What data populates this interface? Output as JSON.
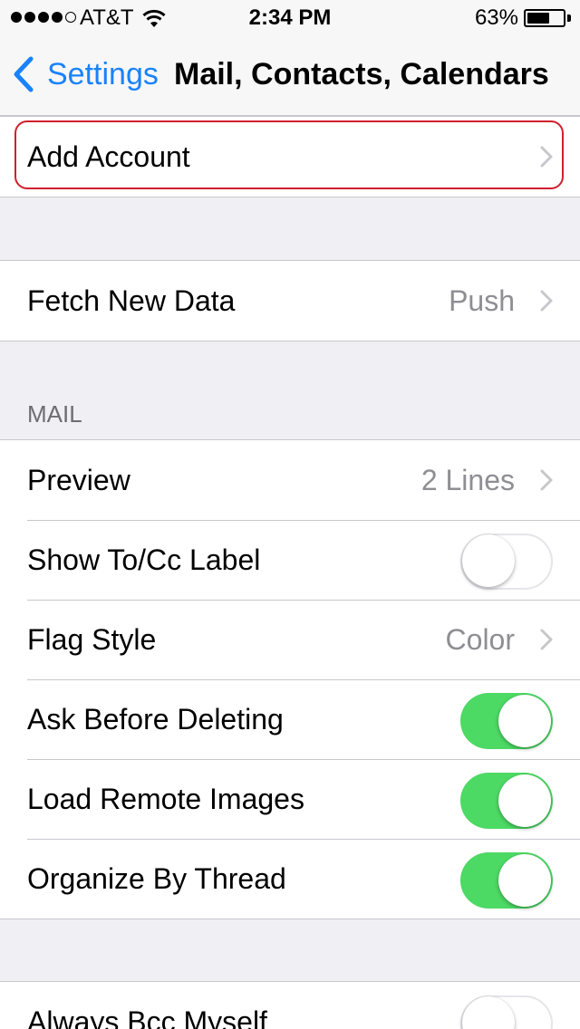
{
  "status_bar": {
    "carrier": "AT&T",
    "time": "2:34 PM",
    "battery_percent": "63%",
    "battery_level": 0.63,
    "signal_bars": 4
  },
  "nav": {
    "back_label": "Settings",
    "title": "Mail, Contacts, Calendars"
  },
  "accounts_group": {
    "add_account": "Add Account"
  },
  "fetch_group": {
    "label": "Fetch New Data",
    "value": "Push"
  },
  "mail_section": {
    "header": "MAIL",
    "preview": {
      "label": "Preview",
      "value": "2 Lines"
    },
    "show_to_cc": {
      "label": "Show To/Cc Label",
      "on": false
    },
    "flag_style": {
      "label": "Flag Style",
      "value": "Color"
    },
    "ask_before_deleting": {
      "label": "Ask Before Deleting",
      "on": true
    },
    "load_remote_images": {
      "label": "Load Remote Images",
      "on": true
    },
    "organize_by_thread": {
      "label": "Organize By Thread",
      "on": true
    }
  },
  "bcc_group": {
    "always_bcc": {
      "label": "Always Bcc Myself",
      "on": false
    }
  },
  "colors": {
    "accent": "#1a82fb",
    "toggle_on": "#4cd964",
    "highlight": "#d0202e"
  }
}
